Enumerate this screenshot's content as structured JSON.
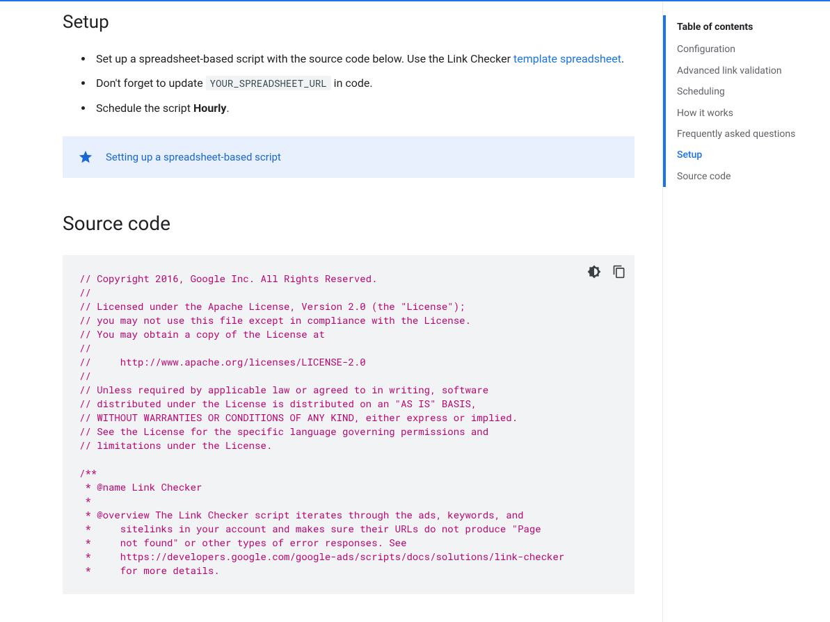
{
  "headings": {
    "setup": "Setup",
    "source": "Source code"
  },
  "steps": {
    "s1": {
      "prefix": "Set up a spreadsheet-based script with the source code below. Use the Link Checker ",
      "link": "template spreadsheet",
      "suffix": "."
    },
    "s2": {
      "prefix": "Don't forget to update ",
      "code": "YOUR_SPREADSHEET_URL",
      "suffix": " in code."
    },
    "s3": {
      "prefix": "Schedule the script ",
      "bold": "Hourly",
      "suffix": "."
    }
  },
  "callout": {
    "link_text": "Setting up a spreadsheet-based script"
  },
  "code": "// Copyright 2016, Google Inc. All Rights Reserved.\n//\n// Licensed under the Apache License, Version 2.0 (the \"License\");\n// you may not use this file except in compliance with the License.\n// You may obtain a copy of the License at\n//\n//     http://www.apache.org/licenses/LICENSE-2.0\n//\n// Unless required by applicable law or agreed to in writing, software\n// distributed under the License is distributed on an \"AS IS\" BASIS,\n// WITHOUT WARRANTIES OR CONDITIONS OF ANY KIND, either express or implied.\n// See the License for the specific language governing permissions and\n// limitations under the License.\n\n/**\n * @name Link Checker\n *\n * @overview The Link Checker script iterates through the ads, keywords, and\n *     sitelinks in your account and makes sure their URLs do not produce \"Page\n *     not found\" or other types of error responses. See\n *     https://developers.google.com/google-ads/scripts/docs/solutions/link-checker\n *     for more details.",
  "toc": {
    "title": "Table of contents",
    "items": [
      {
        "label": "Configuration",
        "active": false
      },
      {
        "label": "Advanced link validation",
        "active": false
      },
      {
        "label": "Scheduling",
        "active": false
      },
      {
        "label": "How it works",
        "active": false
      },
      {
        "label": "Frequently asked questions",
        "active": false
      },
      {
        "label": "Setup",
        "active": true
      },
      {
        "label": "Source code",
        "active": false
      }
    ]
  }
}
